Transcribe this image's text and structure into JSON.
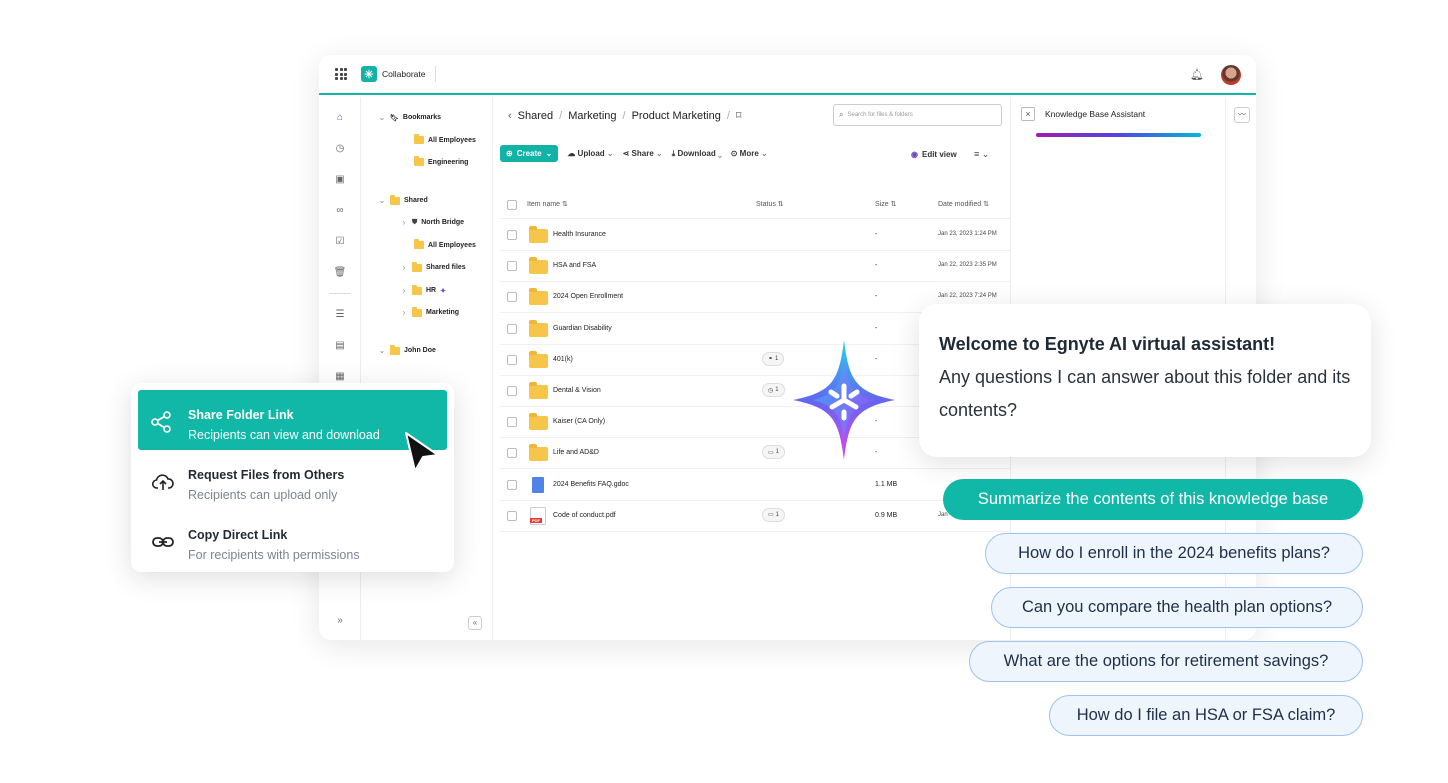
{
  "app": {
    "name": "Collaborate"
  },
  "tree": {
    "bookmarks": "Bookmarks",
    "bookmark_items": [
      "All Employees",
      "Engineering"
    ],
    "shared": "Shared",
    "shared_items": [
      "North Bridge",
      "All Employees",
      "Shared files",
      "HR",
      "Marketing"
    ],
    "user": "John Doe"
  },
  "breadcrumb": [
    "Shared",
    "Marketing",
    "Product Marketing"
  ],
  "search": {
    "placeholder": "Search for files & folders"
  },
  "toolbar": {
    "create": "Create",
    "upload": "Upload",
    "share": "Share",
    "download": "Download",
    "more": "More",
    "edit_view": "Edit view"
  },
  "table": {
    "columns": [
      "Item name",
      "Status",
      "Size",
      "Date modified"
    ],
    "rows": [
      {
        "name": "Health Insurance",
        "type": "folder",
        "status": [],
        "size": "-",
        "date": "Jan 23, 2023 1:24 PM"
      },
      {
        "name": "HSA and FSA",
        "type": "folder",
        "status": [],
        "size": "-",
        "date": "Jan 22, 2023 2:35 PM"
      },
      {
        "name": "2024 Open Enrollment",
        "type": "folder",
        "status": [],
        "size": "-",
        "date": "Jan 22, 2023 7:24 PM"
      },
      {
        "name": "Guardian Disability",
        "type": "folder",
        "status": [],
        "size": "-",
        "date": ""
      },
      {
        "name": "401(k)",
        "type": "folder",
        "status": [
          {
            "icon": "link-icon",
            "count": "1"
          }
        ],
        "size": "-",
        "date": ""
      },
      {
        "name": "Dental & Vision",
        "type": "folder",
        "status": [
          {
            "icon": "clock-icon",
            "count": "1"
          }
        ],
        "size": "",
        "date": ""
      },
      {
        "name": "Kaiser (CA Only)",
        "type": "folder",
        "status": [],
        "size": "-",
        "date": ""
      },
      {
        "name": "Life and AD&D",
        "type": "folder",
        "status": [
          {
            "icon": "comment-icon",
            "count": "1"
          }
        ],
        "size": "-",
        "date": ""
      },
      {
        "name": "2024 Benefits FAQ.gdoc",
        "type": "gdoc",
        "status": [],
        "size": "1.1 MB",
        "date": ""
      },
      {
        "name": "Code of conduct.pdf",
        "type": "pdf",
        "status": [
          {
            "icon": "comment-icon",
            "count": "1"
          }
        ],
        "size": "0.9 MB",
        "date": "Jan"
      }
    ]
  },
  "pdf_badge": "PDF",
  "kb_panel": {
    "title": "Knowledge Base Assistant"
  },
  "share_menu": [
    {
      "title": "Share Folder Link",
      "subtitle": "Recipients can view and download",
      "icon": "share-icon"
    },
    {
      "title": "Request Files from Others",
      "subtitle": "Recipients can upload only",
      "icon": "cloud-upload-icon"
    },
    {
      "title": "Copy Direct Link",
      "subtitle": "For recipients with permissions",
      "icon": "link-icon"
    }
  ],
  "assistant": {
    "heading": "Welcome to Egnyte AI virtual assistant!",
    "message": "Any questions I can answer about this folder and its contents?"
  },
  "suggestions": [
    "Summarize the contents of this knowledge base",
    "How do I enroll in the 2024 benefits plans?",
    "Can you compare the health plan options?",
    "What are the options for retirement savings?",
    "How do I file an HSA or FSA claim?"
  ],
  "colors": {
    "accent": "#12b8a7",
    "suggestion_border": "#9ec3ec",
    "kb_gradient": [
      "#a21caf",
      "#4f46e5",
      "#06b6d4"
    ]
  }
}
